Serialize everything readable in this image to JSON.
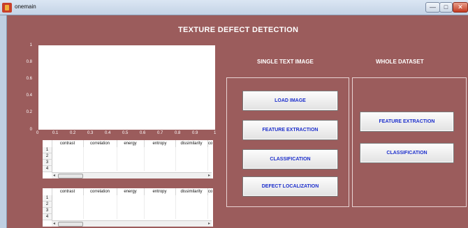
{
  "window": {
    "title": "onemain",
    "controls": {
      "min": "—",
      "max": "□",
      "close": "✕"
    }
  },
  "app": {
    "title": "TEXTURE  DEFECT DETECTION"
  },
  "plot": {
    "yticks": [
      "1",
      "0.8",
      "0.6",
      "0.4",
      "0.2",
      "0"
    ],
    "xticks": [
      "0",
      "0.1",
      "0.2",
      "0.3",
      "0.4",
      "0.5",
      "0.6",
      "0.7",
      "0.8",
      "0.9",
      "1"
    ]
  },
  "table1": {
    "columns": [
      "contrast",
      "correlation",
      "energy",
      "entropy",
      "dissimilarity",
      "co"
    ],
    "rows": [
      "1",
      "2",
      "3",
      "4"
    ],
    "scroll": {
      "left": "◂",
      "right": "▸",
      "thumb": "≡"
    }
  },
  "table2": {
    "columns": [
      "contrast",
      "correlation",
      "energy",
      "entropy",
      "dissimilarity",
      "co"
    ],
    "rows": [
      "1",
      "2",
      "3",
      "4"
    ],
    "scroll": {
      "left": "◂",
      "right": "▸",
      "thumb": "≡"
    }
  },
  "single": {
    "title": "SINGLE TEXT IMAGE",
    "buttons": [
      "LOAD IMAGE",
      "FEATURE EXTRACTION",
      "CLASSIFICATION",
      "DEFECT LOCALIZATION"
    ]
  },
  "whole": {
    "title": "WHOLE DATASET",
    "buttons": [
      "FEATURE EXTRACTION",
      "CLASSIFICATION"
    ]
  }
}
